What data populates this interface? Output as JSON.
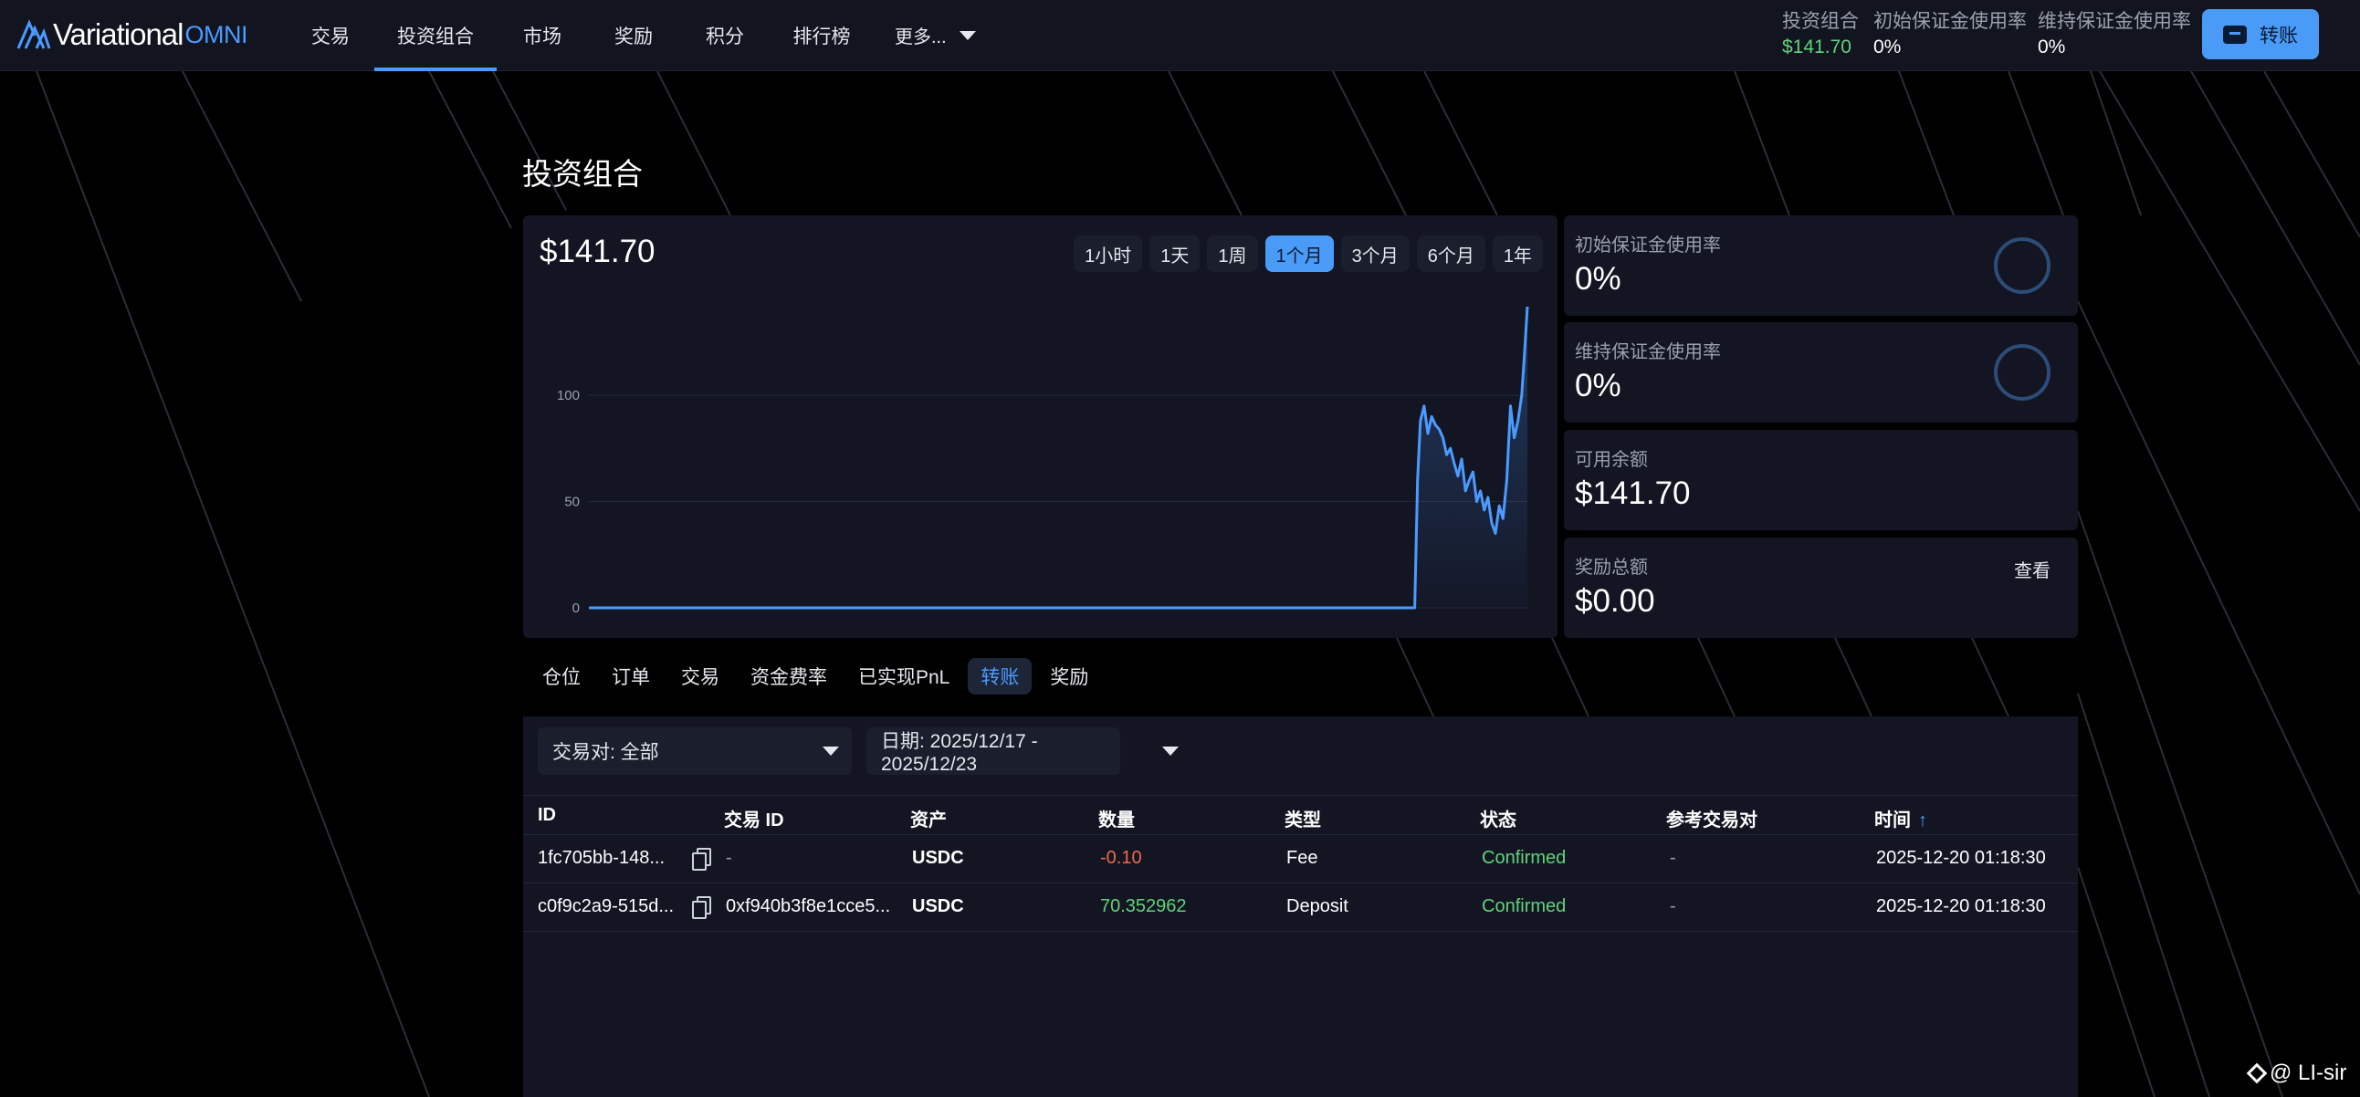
{
  "nav": {
    "logo_word": "Variational",
    "logo_omni": "OMNI",
    "items": [
      {
        "label": "交易"
      },
      {
        "label": "投资组合"
      },
      {
        "label": "市场"
      },
      {
        "label": "奖励"
      },
      {
        "label": "积分"
      },
      {
        "label": "排行榜"
      }
    ],
    "active_index": 1,
    "more_label": "更多..."
  },
  "header_stats": {
    "portfolio_label": "投资组合",
    "portfolio_value": "$141.70",
    "initial_margin_label": "初始保证金使用率",
    "initial_margin_value": "0%",
    "maintenance_margin_label": "维持保证金使用率",
    "maintenance_margin_value": "0%"
  },
  "transfer_button": "转账",
  "page_title": "投资组合",
  "portfolio_chart": {
    "value": "$141.70",
    "ranges": [
      "1小时",
      "1天",
      "1周",
      "1个月",
      "3个月",
      "6个月",
      "1年"
    ],
    "active_range": "1个月"
  },
  "chart_data": {
    "type": "area",
    "title": "",
    "xlabel": "",
    "ylabel": "",
    "ylim": [
      0,
      141.7
    ],
    "yticks": [
      0,
      50,
      100
    ],
    "grid": true,
    "series": [
      {
        "x": [
          0,
          20,
          40,
          60,
          80,
          88.0,
          88.3,
          88.6,
          89.0,
          89.4,
          89.8,
          90.2,
          90.6,
          91.0,
          91.4,
          91.8,
          92.2,
          92.6,
          93.0,
          93.4,
          93.8,
          94.2,
          94.6,
          95.0,
          95.4,
          95.8,
          96.2,
          96.6,
          97.0,
          97.4,
          97.8,
          98.2,
          98.6,
          99.0,
          99.4,
          99.7,
          100
        ],
        "y": [
          0,
          0,
          0,
          0,
          0,
          0,
          60,
          88,
          95,
          82,
          90,
          86,
          84,
          80,
          72,
          75,
          68,
          62,
          70,
          55,
          60,
          64,
          50,
          55,
          46,
          52,
          40,
          35,
          48,
          42,
          60,
          95,
          80,
          88,
          100,
          120,
          141.7
        ]
      }
    ],
    "color": "#4b9bff"
  },
  "cards": {
    "initial_margin": {
      "label": "初始保证金使用率",
      "value": "0%"
    },
    "maintenance_margin": {
      "label": "维持保证金使用率",
      "value": "0%"
    },
    "available_balance": {
      "label": "可用余额",
      "value": "$141.70"
    },
    "rewards_total": {
      "label": "奖励总额",
      "value": "$0.00",
      "view_label": "查看"
    }
  },
  "tabs": {
    "items": [
      "仓位",
      "订单",
      "交易",
      "资金费率",
      "已实现PnL",
      "转账",
      "奖励"
    ],
    "active": "转账"
  },
  "filters": {
    "pair": "交易对: 全部",
    "date": "日期: 2025/12/17 - 2025/12/23"
  },
  "table": {
    "headers": {
      "id": "ID",
      "tx_id": "交易 ID",
      "asset": "资产",
      "amount": "数量",
      "type": "类型",
      "status": "状态",
      "ref_pair": "参考交易对",
      "time": "时间",
      "sort_arrow": "↑"
    },
    "rows": [
      {
        "id": "1fc705bb-148...",
        "tx_id": "-",
        "asset": "USDC",
        "amount": "-0.10",
        "type": "Fee",
        "status": "Confirmed",
        "ref_pair": "-",
        "time": "2025-12-20 01:18:30"
      },
      {
        "id": "c0f9c2a9-515d...",
        "tx_id": "0xf940b3f8e1cce5...",
        "asset": "USDC",
        "amount": "70.352962",
        "type": "Deposit",
        "status": "Confirmed",
        "ref_pair": "-",
        "time": "2025-12-20 01:18:30"
      }
    ]
  },
  "watermark": "@ LI-sir"
}
